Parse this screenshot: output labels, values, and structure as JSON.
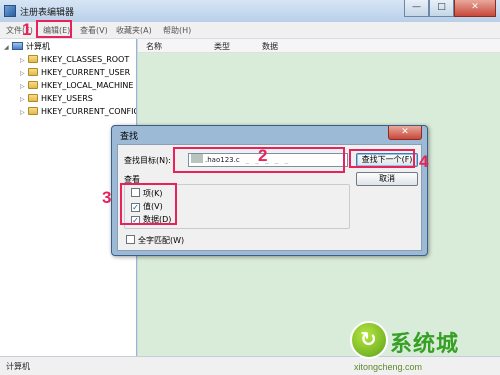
{
  "app": {
    "title": "注册表编辑器",
    "window_buttons": {
      "minimize": "—",
      "maximize": "□",
      "close": "✕"
    }
  },
  "menu": [
    "文件(F)",
    "编辑(E)",
    "查看(V)",
    "收藏夹(A)",
    "帮助(H)"
  ],
  "tree": {
    "root": "计算机",
    "items": [
      "HKEY_CLASSES_ROOT",
      "HKEY_CURRENT_USER",
      "HKEY_LOCAL_MACHINE",
      "HKEY_USERS",
      "HKEY_CURRENT_CONFIG"
    ]
  },
  "list": {
    "columns": [
      "名称",
      "类型",
      "数据"
    ]
  },
  "status": {
    "path": "计算机"
  },
  "find_dialog": {
    "title": "查找",
    "close": "✕",
    "find_what_label": "查找目标(N):",
    "find_what_value": ".hao123.c",
    "find_next_label": "查找下一个(F)",
    "cancel_label": "取消",
    "look_at_label": "查看",
    "options": [
      {
        "label": "项(K)",
        "checked": false
      },
      {
        "label": "值(V)",
        "checked": true
      },
      {
        "label": "数据(D)",
        "checked": true
      }
    ],
    "match_whole_label": "全字匹配(W)",
    "match_whole_checked": false
  },
  "annotations": [
    "1",
    "2",
    "3",
    "4"
  ],
  "watermark": {
    "title": "系统城",
    "site": "xitongcheng.com",
    "colors": {
      "accent": "#e8225a",
      "brand": "#35a023"
    }
  }
}
